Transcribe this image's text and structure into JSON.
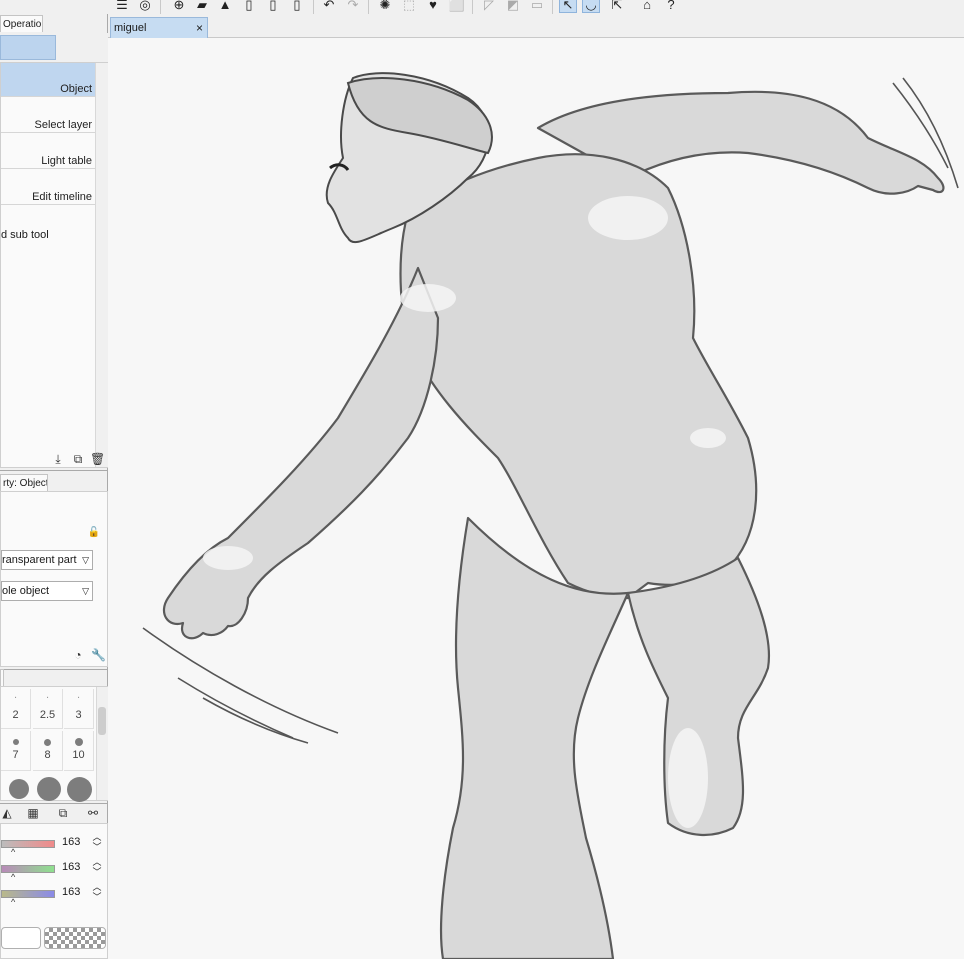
{
  "toolbar": {
    "icons": [
      "menu-icon",
      "layer-icon",
      "new-file-icon",
      "open-folder-icon",
      "save-icon",
      "export-jpg-icon",
      "export-png-icon",
      "export-psd-icon",
      "undo-icon",
      "redo-icon",
      "loading-icon",
      "select-area-icon",
      "fill-icon",
      "transform-icon",
      "clear-icon",
      "fill-selection-icon",
      "deselect-icon",
      "snap-icon",
      "ruler-icon",
      "export-icon",
      "academy-icon",
      "help-icon"
    ],
    "selected": [
      "snap-icon",
      "ruler-icon"
    ]
  },
  "tool_panel": {
    "tab_label": "Operation",
    "sub_tools": [
      {
        "label": "Object",
        "selected": true
      },
      {
        "label": "Select layer",
        "selected": false
      },
      {
        "label": "Light table",
        "selected": false
      },
      {
        "label": "Edit timeline",
        "selected": false
      }
    ],
    "add_sub_tool_label": "d sub tool"
  },
  "property_panel": {
    "tab_label": "rty: Object",
    "transparent_part_option": "ransparent part",
    "object_option": "ole object"
  },
  "brush_size": {
    "labels": [
      "2",
      "2.5",
      "3",
      "7",
      "8",
      "10"
    ],
    "small_marks": [
      ".",
      ".",
      "."
    ]
  },
  "color_sliders": [
    {
      "channel": "red",
      "value": "163",
      "gradient_end": "#f08a8a"
    },
    {
      "channel": "green",
      "value": "163",
      "gradient_end": "#8ee08e"
    },
    {
      "channel": "blue",
      "value": "163",
      "gradient_end": "#8a8ae8"
    }
  ],
  "document": {
    "tab_title": "miguel",
    "close_label": "×"
  },
  "colors": {
    "accent": "#c6dcf2",
    "selection": "#bfd6ef",
    "canvas_bg": "#f7f7f7"
  }
}
